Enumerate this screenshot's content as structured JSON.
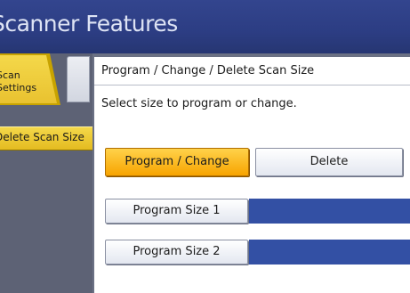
{
  "header": {
    "title": "Scanner Features"
  },
  "left_panel": {
    "tab_label": "Scan\nSettings",
    "selected_item": "Delete Scan Size"
  },
  "dialog": {
    "title": "Program / Change / Delete Scan Size",
    "instruction": "Select size to program or change.",
    "mode_buttons": {
      "program_change": "Program / Change",
      "delete": "Delete"
    },
    "sizes": [
      {
        "label": "Program Size 1"
      },
      {
        "label": "Program Size 2"
      }
    ]
  },
  "colors": {
    "header": "#2c3d83",
    "selected": "#f7a400",
    "size_bar": "#3350a4"
  }
}
